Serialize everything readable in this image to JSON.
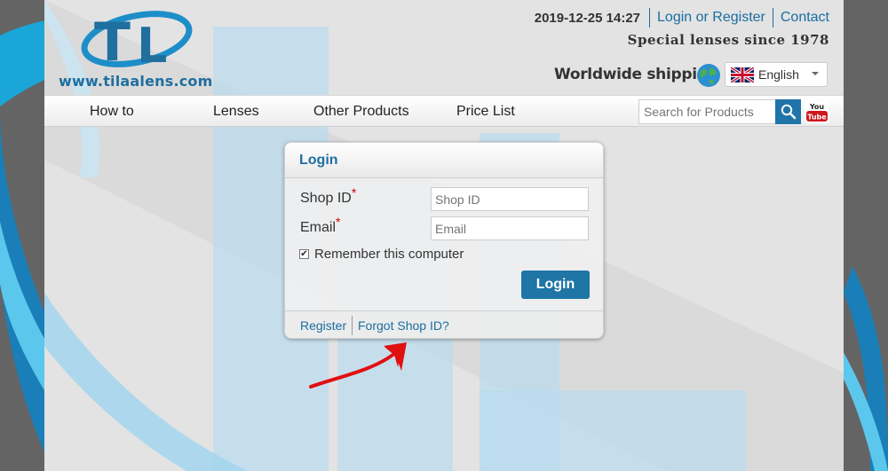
{
  "header": {
    "logo_url": "www.tilaalens.com",
    "datetime": "2019-12-25 14:27",
    "login_register": "Login or Register",
    "contact": "Contact",
    "tagline": "Special lenses since 1978",
    "shipping": "Worldwide shipping",
    "language": "English"
  },
  "nav": {
    "items": [
      "How to",
      "Lenses",
      "Other Products",
      "Price List"
    ],
    "search_placeholder": "Search for Products"
  },
  "login": {
    "title": "Login",
    "shop_id_label": "Shop ID",
    "shop_id_placeholder": "Shop ID",
    "email_label": "Email",
    "email_placeholder": "Email",
    "required_mark": "*",
    "remember_label": "Remember this computer",
    "remember_checked": true,
    "button": "Login",
    "register_link": "Register",
    "forgot_link": "Forgot Shop ID?"
  },
  "colors": {
    "brand_blue": "#1e75a6",
    "annotation_red": "#e01010"
  }
}
